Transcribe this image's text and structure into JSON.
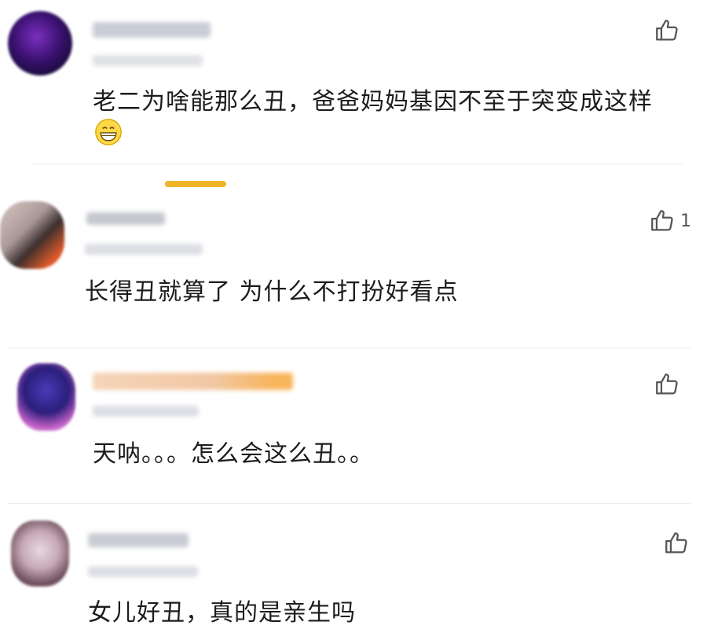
{
  "comments": [
    {
      "text": "老二为啥能那么丑，爸爸妈妈基因不至于突变成这样",
      "likes": "",
      "emoji": "grin-emoji"
    },
    {
      "text": "长得丑就算了 为什么不打扮好看点",
      "likes": "1"
    },
    {
      "text": "天呐。。。怎么会这么丑。。",
      "likes": ""
    },
    {
      "text": "女儿好丑，真的是亲生吗",
      "likes": ""
    }
  ],
  "icons": {
    "like": "thumbs-up-icon",
    "emoji": "grin-emoji-icon"
  },
  "colors": {
    "accent": "#f0b429",
    "text": "#1c1c1c",
    "icon": "#555555",
    "divider": "#ececec"
  }
}
